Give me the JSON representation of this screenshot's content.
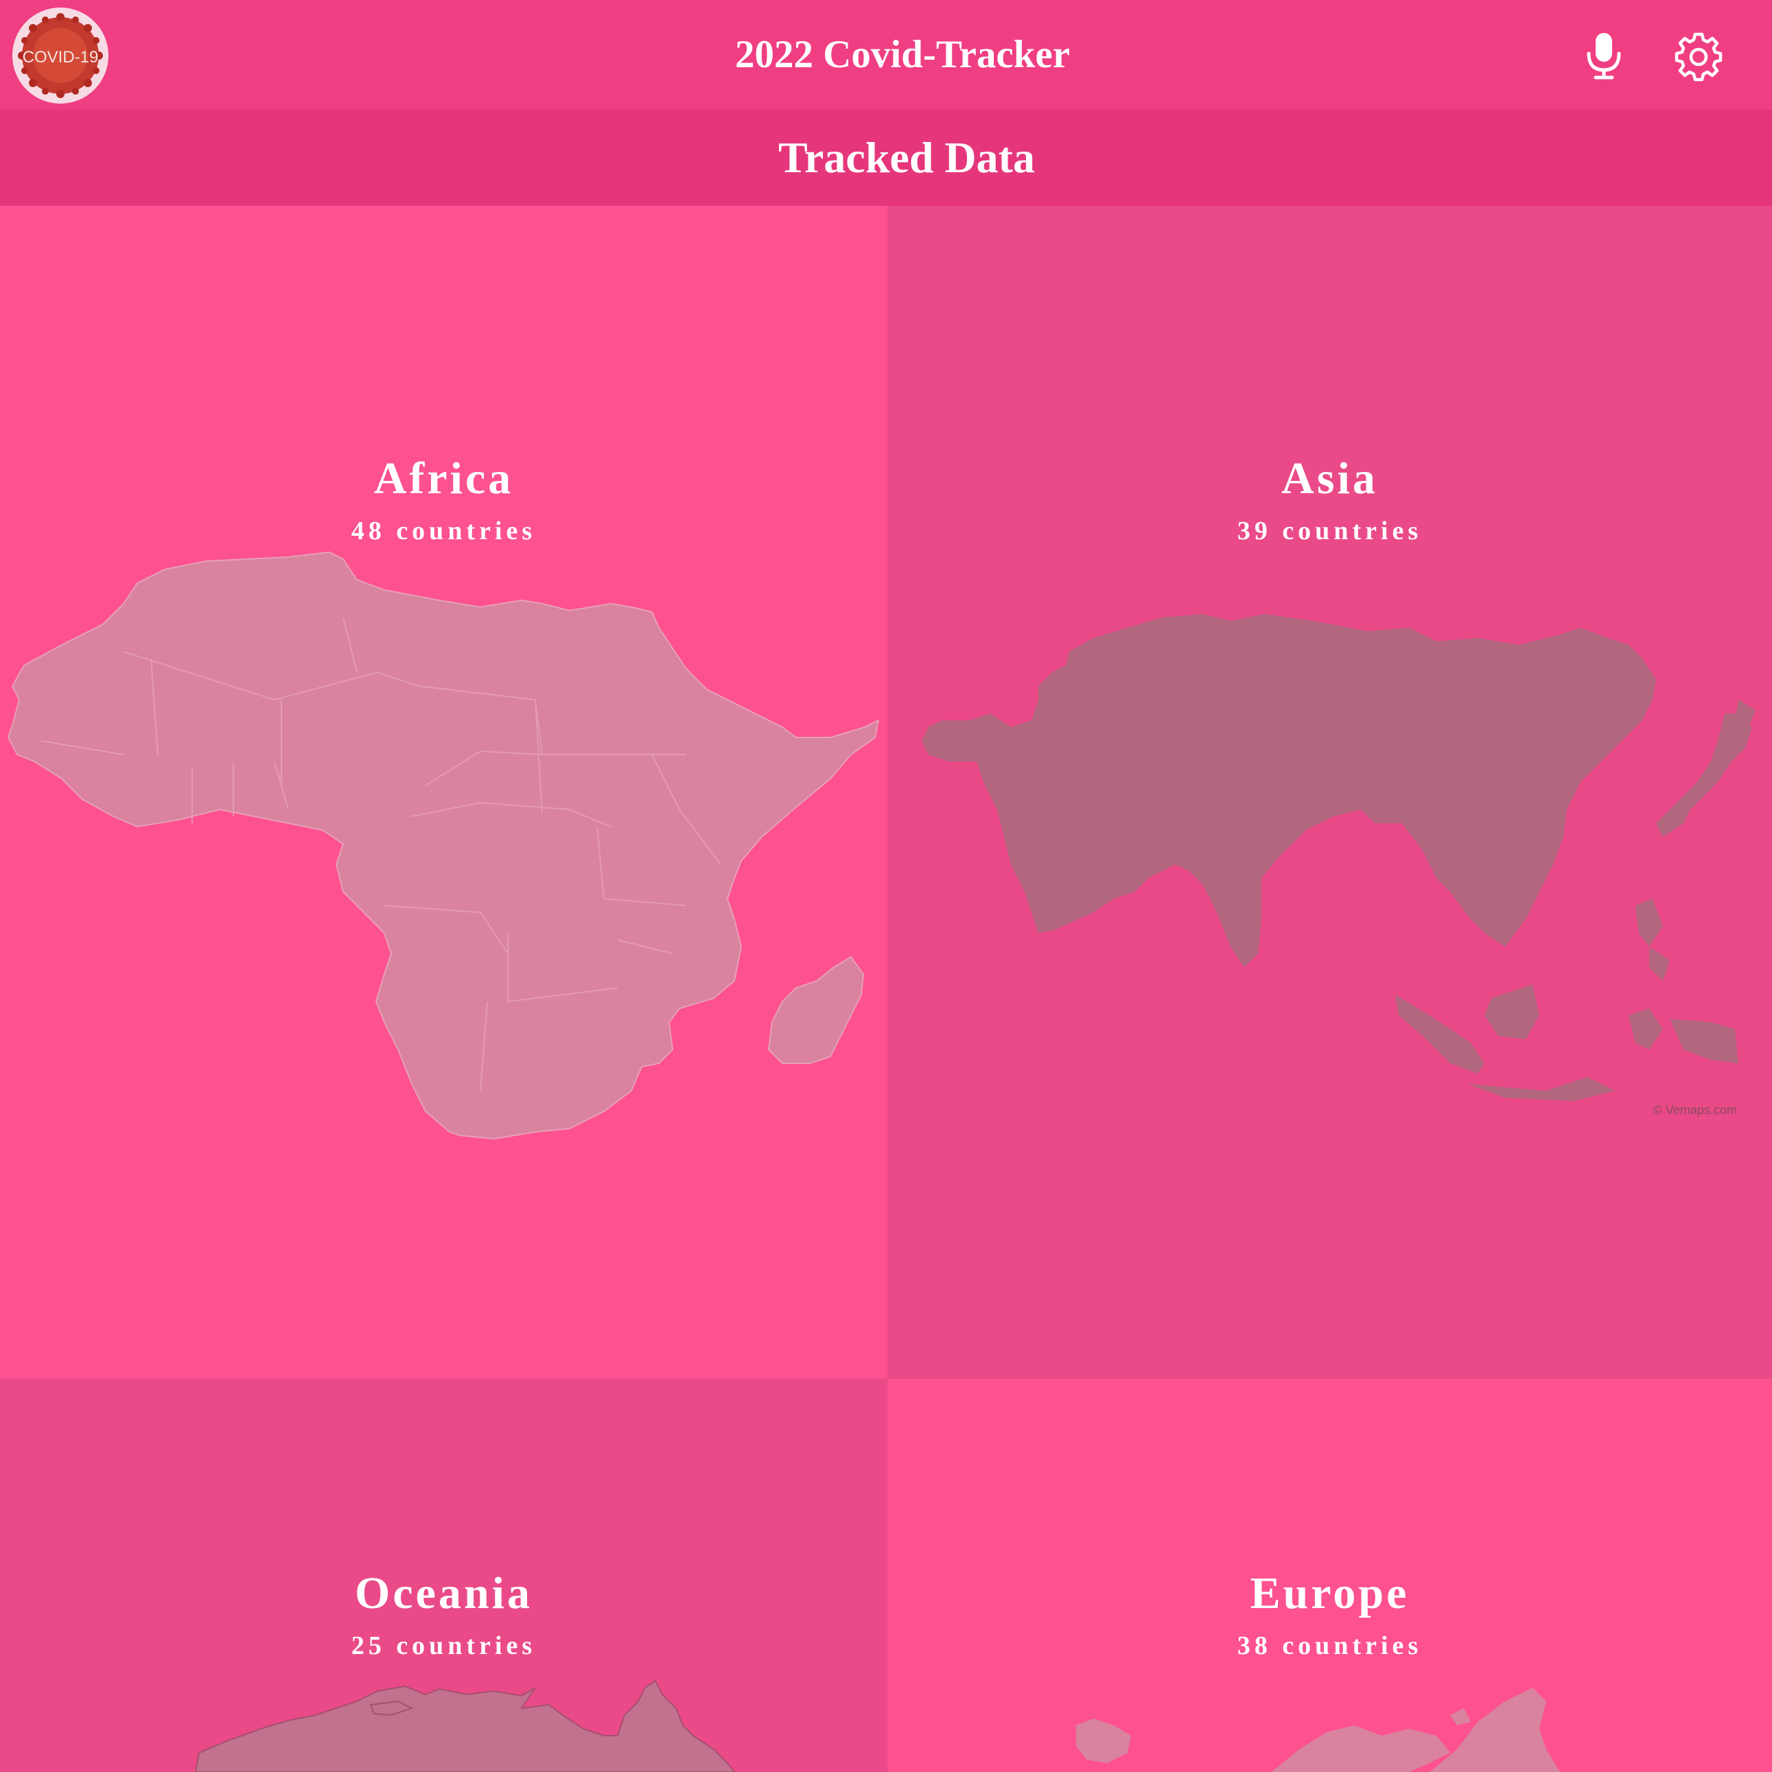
{
  "app": {
    "title": "2022 Covid-Tracker",
    "logo_text": "COVID-19"
  },
  "header": {
    "icons": [
      "microphone-icon",
      "gear-icon"
    ]
  },
  "section": {
    "title": "Tracked Data"
  },
  "regions": [
    {
      "name": "Africa",
      "count_label": "48 countries"
    },
    {
      "name": "Asia",
      "count_label": "39 countries"
    },
    {
      "name": "Oceania",
      "count_label": "25 countries"
    },
    {
      "name": "Europe",
      "count_label": "38 countries"
    }
  ],
  "map_credit": "© Vemaps.com",
  "colors": {
    "header": "#f03e83",
    "subheader": "#e6367b",
    "tile_bright": "#fd5190",
    "tile_dim": "#ea4a88"
  }
}
